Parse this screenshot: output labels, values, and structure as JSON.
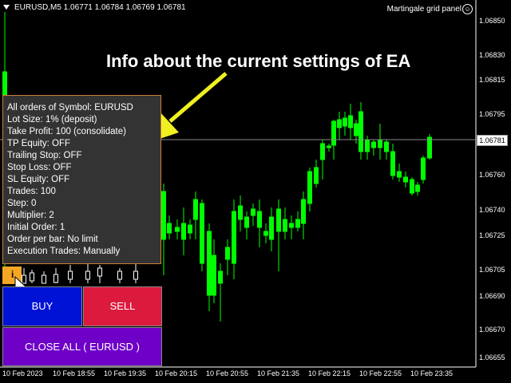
{
  "header": {
    "symbol_info": "EURUSD,M5  1.06771 1.06784 1.06769 1.06781"
  },
  "panel_title": "Martingale grid panel",
  "annotation": "Info about the current settings of EA",
  "current_price": "1.06781",
  "price_axis": [
    "1.06850",
    "1.06830",
    "1.06815",
    "1.06795",
    "1.06781",
    "1.06760",
    "1.06740",
    "1.06725",
    "1.06705",
    "1.06690",
    "1.06670",
    "1.06655"
  ],
  "time_axis": [
    "10 Feb 2023",
    "10 Feb 18:55",
    "10 Feb 19:35",
    "10 Feb 20:15",
    "10 Feb 20:55",
    "10 Feb 21:35",
    "10 Feb 22:15",
    "10 Feb 22:55",
    "10 Feb 23:35"
  ],
  "info_lines": [
    "All orders of Symbol: EURUSD",
    "Lot Size: 1% (deposit)",
    "Take Profit: 100 (consolidate)",
    "TP Equity: OFF",
    "Trailing Stop: OFF",
    "Stop Loss: OFF",
    "SL Equity: OFF",
    "Trades: 100",
    "Step: 0",
    "Multiplier: 2",
    "Initial Order: 1",
    "Order per bar: No limit",
    "Execution Trades: Manually"
  ],
  "info_button": "i",
  "buttons": {
    "buy": "BUY",
    "sell": "SELL",
    "close_all": "CLOSE ALL  ( EURUSD )"
  },
  "colors": {
    "bull": "#ffffff",
    "bear": "#00ff00",
    "buy": "#0012d6",
    "sell": "#dc1a3d",
    "close": "#6e00c8",
    "info": "#f5a623"
  }
}
